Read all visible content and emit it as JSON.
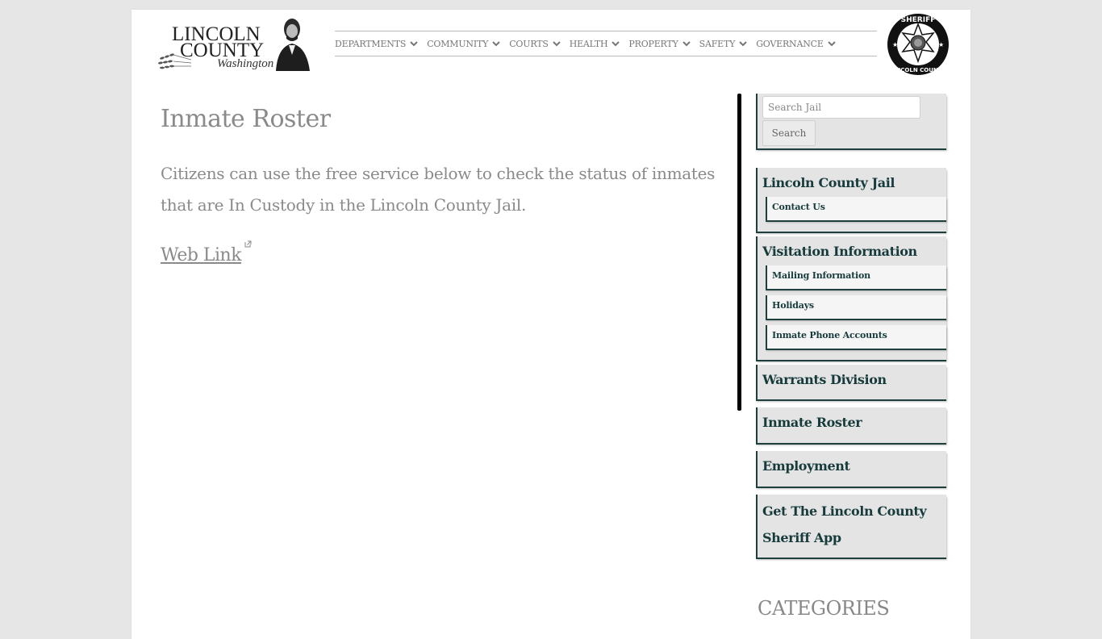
{
  "header": {
    "logo": {
      "line1": "LINCOLN",
      "line2": "COUNTY",
      "line3": "Washington"
    },
    "nav": [
      {
        "label": "DEPARTMENTS",
        "icon": "chevron-down-icon"
      },
      {
        "label": "COMMUNITY",
        "icon": "chevron-down-icon"
      },
      {
        "label": "COURTS",
        "icon": "chevron-down-icon"
      },
      {
        "label": "HEALTH",
        "icon": "chevron-down-icon"
      },
      {
        "label": "PROPERTY",
        "icon": "chevron-down-icon"
      },
      {
        "label": "SAFETY",
        "icon": "chevron-down-icon"
      },
      {
        "label": "GOVERNANCE",
        "icon": "chevron-down-icon"
      }
    ],
    "badge": {
      "top_text": "SHERIFF",
      "bottom_text": "LINCOLN COUNTY"
    }
  },
  "main": {
    "title": "Inmate Roster",
    "intro": "Citizens can use the free service below to check the status of inmates that are In Custody in the Lincoln County Jail.",
    "link_label": "Web Link",
    "link_icon": "external-link-icon"
  },
  "sidebar": {
    "search": {
      "placeholder": "Search Jail",
      "value": "",
      "button_label": "Search"
    },
    "widgets": [
      {
        "title": "Lincoln County Jail",
        "items": [
          "Contact Us"
        ]
      },
      {
        "title": "Visitation Information",
        "items": [
          "Mailing Information",
          "Holidays",
          "Inmate Phone Accounts"
        ]
      },
      {
        "title": "Warrants Division",
        "items": []
      },
      {
        "title": "Inmate Roster",
        "items": []
      },
      {
        "title": "Employment",
        "items": []
      },
      {
        "title": "Get The Lincoln County Sheriff App",
        "items": []
      }
    ],
    "categories_heading": "CATEGORIES"
  },
  "colors": {
    "page_bg": "#e6e6e6",
    "text_gray": "#8a8a8a",
    "sidebar_dark": "#173b3c",
    "widget_bg": "#e4e4e4"
  }
}
